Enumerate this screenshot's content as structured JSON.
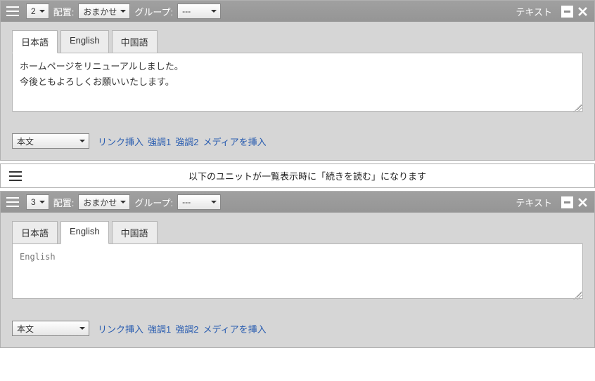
{
  "unit1": {
    "order": "2",
    "layoutLabel": "配置:",
    "layoutValue": "おまかせ",
    "groupLabel": "グループ:",
    "groupValue": "---",
    "typeLabel": "テキスト",
    "tabs": {
      "ja": "日本語",
      "en": "English",
      "zh": "中国語"
    },
    "activeTab": "ja",
    "content": "ホームページをリニューアルしました。\n今後ともよろしくお願いいたします。",
    "styleSelect": "本文",
    "actions": {
      "link": "リンク挿入",
      "em1": "強調1",
      "em2": "強調2",
      "media": "メディアを挿入"
    }
  },
  "separator": {
    "message": "以下のユニットが一覧表示時に「続きを読む」になります"
  },
  "unit2": {
    "order": "3",
    "layoutLabel": "配置:",
    "layoutValue": "おまかせ",
    "groupLabel": "グループ:",
    "groupValue": "---",
    "typeLabel": "テキスト",
    "tabs": {
      "ja": "日本語",
      "en": "English",
      "zh": "中国語"
    },
    "activeTab": "en",
    "placeholder": "English",
    "styleSelect": "本文",
    "actions": {
      "link": "リンク挿入",
      "em1": "強調1",
      "em2": "強調2",
      "media": "メディアを挿入"
    }
  }
}
